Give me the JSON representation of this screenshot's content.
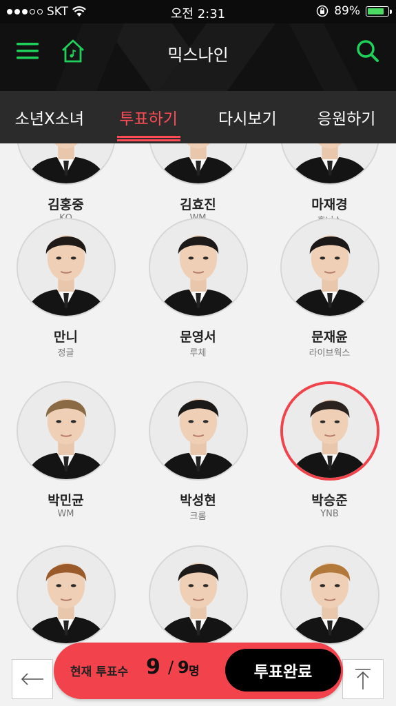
{
  "status_bar": {
    "carrier": "SKT",
    "time": "오전 2:31",
    "battery": "89%",
    "battery_level": 0.89
  },
  "header": {
    "title": "믹스나인",
    "menu_icon": "hamburger-icon",
    "home_icon": "home-music-icon",
    "search_icon": "search-icon",
    "accent": "#1fd15a"
  },
  "tabs": [
    {
      "label": "소년X소녀",
      "active": false
    },
    {
      "label": "투표하기",
      "active": true
    },
    {
      "label": "다시보기",
      "active": false
    },
    {
      "label": "응원하기",
      "active": false
    }
  ],
  "contestants": [
    {
      "name": "김홍중",
      "agency": "KQ",
      "selected": false
    },
    {
      "name": "김효진",
      "agency": "WM",
      "selected": false
    },
    {
      "name": "마재경",
      "agency": "후너스",
      "selected": false
    },
    {
      "name": "만니",
      "agency": "정글",
      "selected": false
    },
    {
      "name": "문영서",
      "agency": "루체",
      "selected": false
    },
    {
      "name": "문재윤",
      "agency": "라이브웍스",
      "selected": false
    },
    {
      "name": "박민균",
      "agency": "WM",
      "selected": false
    },
    {
      "name": "박성현",
      "agency": "크롬",
      "selected": false
    },
    {
      "name": "박승준",
      "agency": "YNB",
      "selected": true
    },
    {
      "name": "",
      "agency": "",
      "selected": false
    },
    {
      "name": "",
      "agency": "",
      "selected": false
    },
    {
      "name": "",
      "agency": "",
      "selected": false
    }
  ],
  "vote_bar": {
    "label": "현재 투표수",
    "current": "9",
    "separator": "/",
    "total": "9",
    "unit": "명",
    "done_label": "투표완료",
    "color": "#f2434d"
  },
  "nav": {
    "back_icon": "arrow-left-icon",
    "top_icon": "arrow-up-to-top-icon"
  }
}
